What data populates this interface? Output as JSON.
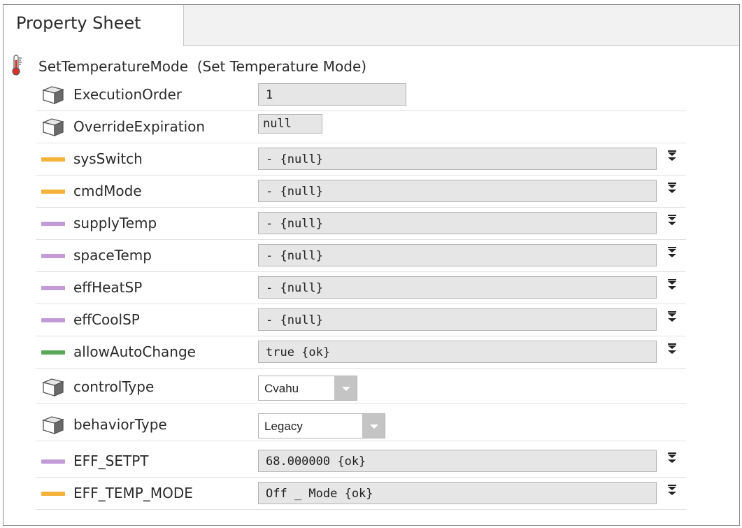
{
  "tab": {
    "label": "Property Sheet"
  },
  "component": {
    "name": "SetTemperatureMode",
    "display_name": "(Set Temperature Mode)",
    "icon": "thermometer-icon"
  },
  "colors": {
    "orange": "#f5b23a",
    "purple": "#c19bd6",
    "green": "#58a858",
    "field_bg": "#e6e6e6"
  },
  "properties": [
    {
      "label": "ExecutionOrder",
      "icon": "slot-cube-icon",
      "value": "1"
    },
    {
      "label": "OverrideExpiration",
      "icon": "slot-cube-icon",
      "value": "null"
    },
    {
      "label": "sysSwitch",
      "icon": "enum-slot-icon",
      "value": "- {null}"
    },
    {
      "label": "cmdMode",
      "icon": "enum-slot-icon",
      "value": "- {null}"
    },
    {
      "label": "supplyTemp",
      "icon": "numeric-slot-icon",
      "value": "- {null}"
    },
    {
      "label": "spaceTemp",
      "icon": "numeric-slot-icon",
      "value": "- {null}"
    },
    {
      "label": "effHeatSP",
      "icon": "numeric-slot-icon",
      "value": "- {null}"
    },
    {
      "label": "effCoolSP",
      "icon": "numeric-slot-icon",
      "value": "- {null}"
    },
    {
      "label": "allowAutoChange",
      "icon": "boolean-slot-icon",
      "value": "true {ok}"
    },
    {
      "label": "controlType",
      "icon": "slot-cube-icon",
      "value": "Cvahu"
    },
    {
      "label": "behaviorType",
      "icon": "slot-cube-icon",
      "value": "Legacy"
    },
    {
      "label": "EFF_SETPT",
      "icon": "numeric-slot-icon",
      "value": "68.000000 {ok}"
    },
    {
      "label": "EFF_TEMP_MODE",
      "icon": "enum-slot-icon",
      "value": "Off _ Mode {ok}"
    }
  ]
}
